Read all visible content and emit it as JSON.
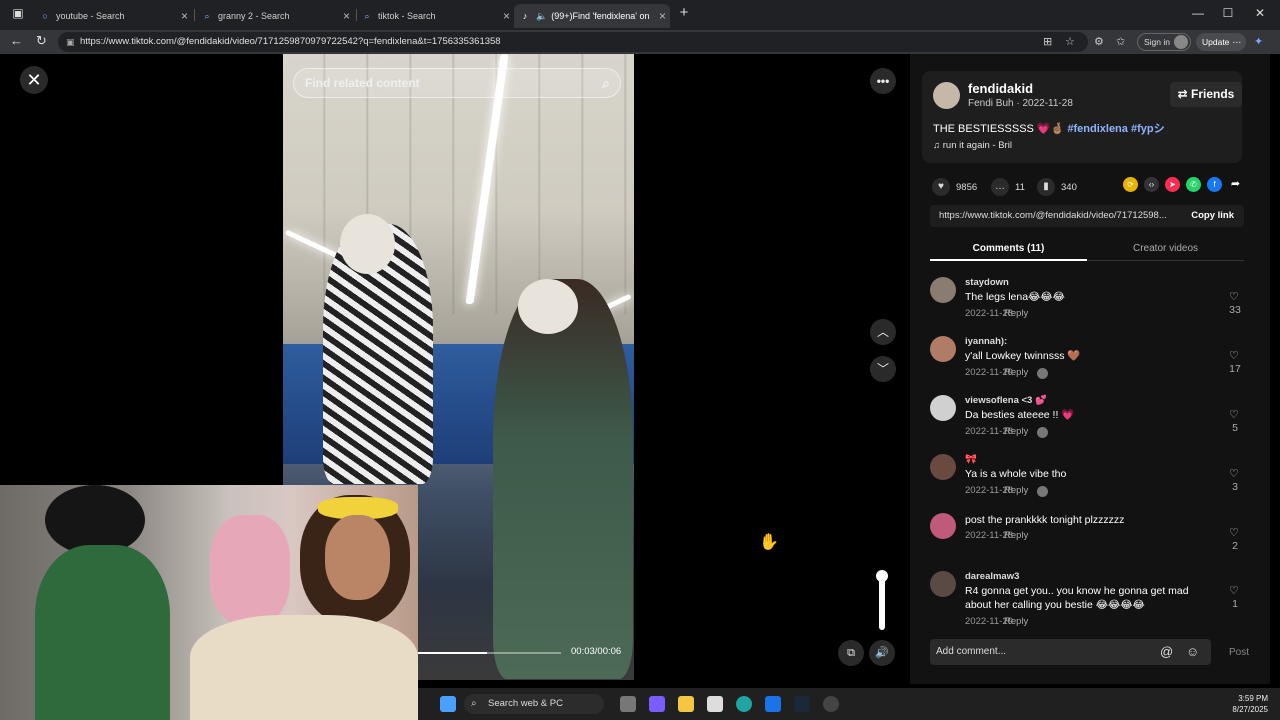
{
  "browser": {
    "tabs": [
      {
        "title": "youtube - Search",
        "active": false
      },
      {
        "title": "granny 2 - Search",
        "active": false
      },
      {
        "title": "tiktok - Search",
        "active": false
      },
      {
        "title": "(99+)Find 'fendixlena' on Tik",
        "active": true
      }
    ],
    "new_tab": "+",
    "url": "https://www.tiktok.com/@fendidakid/video/7171259870979722542?q=fendixlena&t=1756335361358",
    "signin_label": "Sign in",
    "update_label": "Update"
  },
  "video": {
    "search_placeholder": "Find related content",
    "timecode": "00:03/00:06",
    "progress_fraction": 0.5
  },
  "author": {
    "username": "fendidakid",
    "subtitle": "Fendi Buh · 2022-11-28",
    "friends_label": "Friends"
  },
  "post": {
    "caption_text": "THE BESTIESSSSS 💗🤞🏽",
    "hashtags": "#fendixlena #fypシ",
    "music": "run it again - Bril"
  },
  "stats": {
    "likes": "9856",
    "comments": "11",
    "saves": "340"
  },
  "share_link": {
    "url": "https://www.tiktok.com/@fendidakid/video/71712598...",
    "copy_label": "Copy link"
  },
  "panel_tabs": {
    "comments": "Comments (11)",
    "creator": "Creator videos"
  },
  "comments": [
    {
      "user": "staydown",
      "text": "The legs lena😂😂😂",
      "date": "2022-11-28",
      "reply": "Reply",
      "likes": "33",
      "avatar_color": "#8a7c70"
    },
    {
      "user": "iyannah):",
      "text": "y'all Lowkey twinnsss 🤎",
      "date": "2022-11-29",
      "reply": "Reply",
      "likes": "17",
      "avatar_color": "#b07c66"
    },
    {
      "user": "viewsoflena  <3  💕",
      "text": "Da besties ateeee !! 💗",
      "date": "2022-11-28",
      "reply": "Reply",
      "likes": "5",
      "avatar_color": "#d0d0d0"
    },
    {
      "user": "🎀",
      "text": "Ya is a whole vibe tho",
      "date": "2022-11-28",
      "reply": "Reply",
      "likes": "3",
      "avatar_color": "#6a4a40"
    },
    {
      "user": "",
      "text": "post the prankkkk tonight plzzzzzz",
      "date": "2022-11-28",
      "reply": "Reply",
      "likes": "2",
      "avatar_color": "#c05a7a"
    },
    {
      "user": "darealmaw3",
      "text": "R4 gonna get you.. you know he gonna get mad about her calling you bestie 😂😂😂😂",
      "date": "2022-11-29",
      "reply": "Reply",
      "likes": "1",
      "avatar_color": "#5a4a44"
    }
  ],
  "comment_input": {
    "placeholder": "Add comment...",
    "post_label": "Post"
  },
  "taskbar": {
    "search_label": "Search web & PC",
    "time": "3:59 PM",
    "date": "8/27/2025"
  },
  "colors": {
    "accent_link": "#8fb3ff",
    "panel_bg": "#121212",
    "card_bg": "#1e1e1e"
  }
}
